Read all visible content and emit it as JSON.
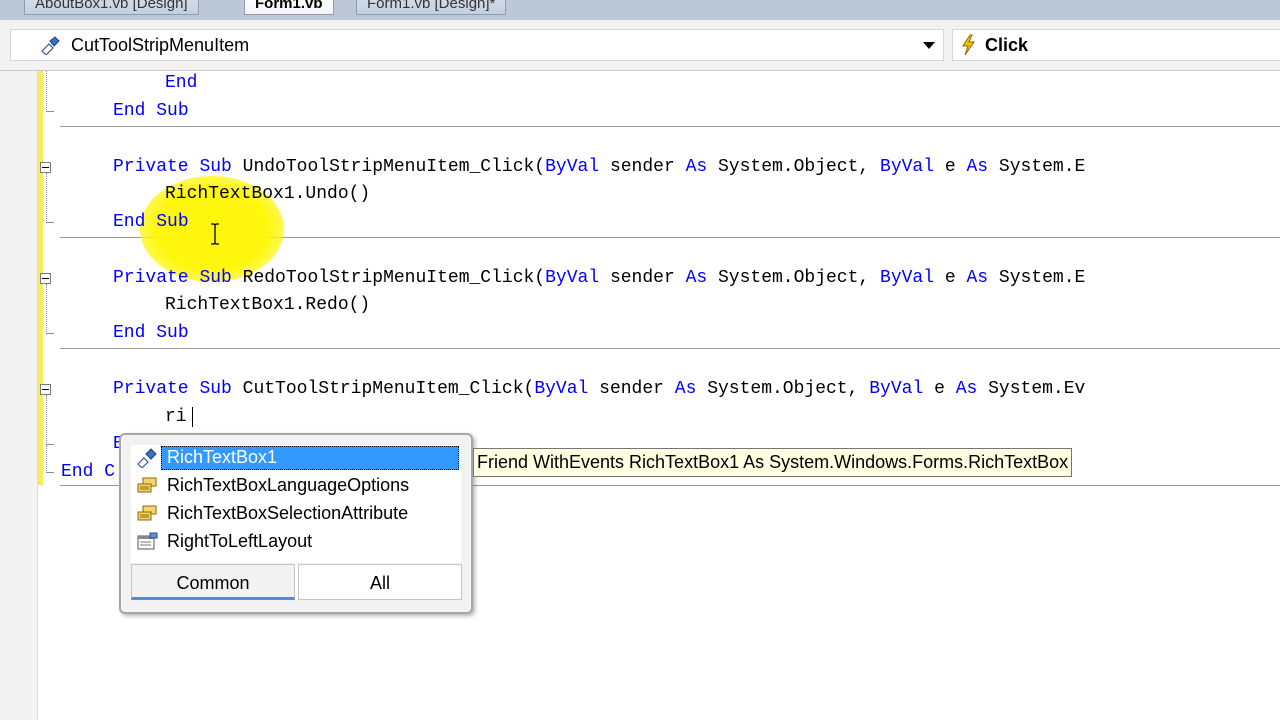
{
  "tabs": [
    {
      "label": "AboutBox1.vb [Design]"
    },
    {
      "label": "Form1.vb"
    },
    {
      "label": "Form1.vb [Design]*"
    }
  ],
  "navbar": {
    "class_dropdown": "CutToolStripMenuItem",
    "method_dropdown": "Click"
  },
  "code": {
    "l1": {
      "end": "End"
    },
    "l2": {
      "end": "End",
      "sub": "Sub"
    },
    "l3": {
      "private": "Private",
      "sub": "Sub",
      "name": "UndoToolStripMenuItem_Click(",
      "byval1": "ByVal",
      "sender": "sender",
      "as1": "As",
      "obj": "System.Object,",
      "byval2": "ByVal",
      "e": "e",
      "as2": "As",
      "ev": "System.E"
    },
    "l4": {
      "text": "RichTextBox1.Undo()"
    },
    "l5": {
      "end": "End",
      "sub": "Sub"
    },
    "l6": {
      "private": "Private",
      "sub": "Sub",
      "name": "RedoToolStripMenuItem_Click(",
      "byval1": "ByVal",
      "sender": "sender",
      "as1": "As",
      "obj": "System.Object,",
      "byval2": "ByVal",
      "e": "e",
      "as2": "As",
      "ev": "System.E"
    },
    "l7": {
      "text": "RichTextBox1.Redo()"
    },
    "l8": {
      "end": "End",
      "sub": "Sub"
    },
    "l9": {
      "private": "Private",
      "sub": "Sub",
      "name": "CutToolStripMenuItem_Click(",
      "byval1": "ByVal",
      "sender": "sender",
      "as1": "As",
      "obj": "System.Object,",
      "byval2": "ByVal",
      "e": "e",
      "as2": "As",
      "ev": "System.Ev"
    },
    "l10": {
      "text": "ri"
    },
    "l11": {
      "text": "E"
    },
    "l12": {
      "text": "End C"
    }
  },
  "intellisense": {
    "items": [
      {
        "label": "RichTextBox1",
        "icon": "field-icon",
        "selected": true
      },
      {
        "label": "RichTextBoxLanguageOptions",
        "icon": "enum-icon"
      },
      {
        "label": "RichTextBoxSelectionAttribute",
        "icon": "enum-icon"
      },
      {
        "label": "RightToLeftLayout",
        "icon": "property-icon"
      }
    ],
    "tabs": {
      "common": "Common",
      "all": "All"
    },
    "tooltip": "Friend WithEvents RichTextBox1 As System.Windows.Forms.RichTextBox"
  },
  "colors": {
    "keyword": "#0000ff",
    "selection": "#3399ff",
    "highlight": "#fff600",
    "changebar": "#f4ec63"
  }
}
